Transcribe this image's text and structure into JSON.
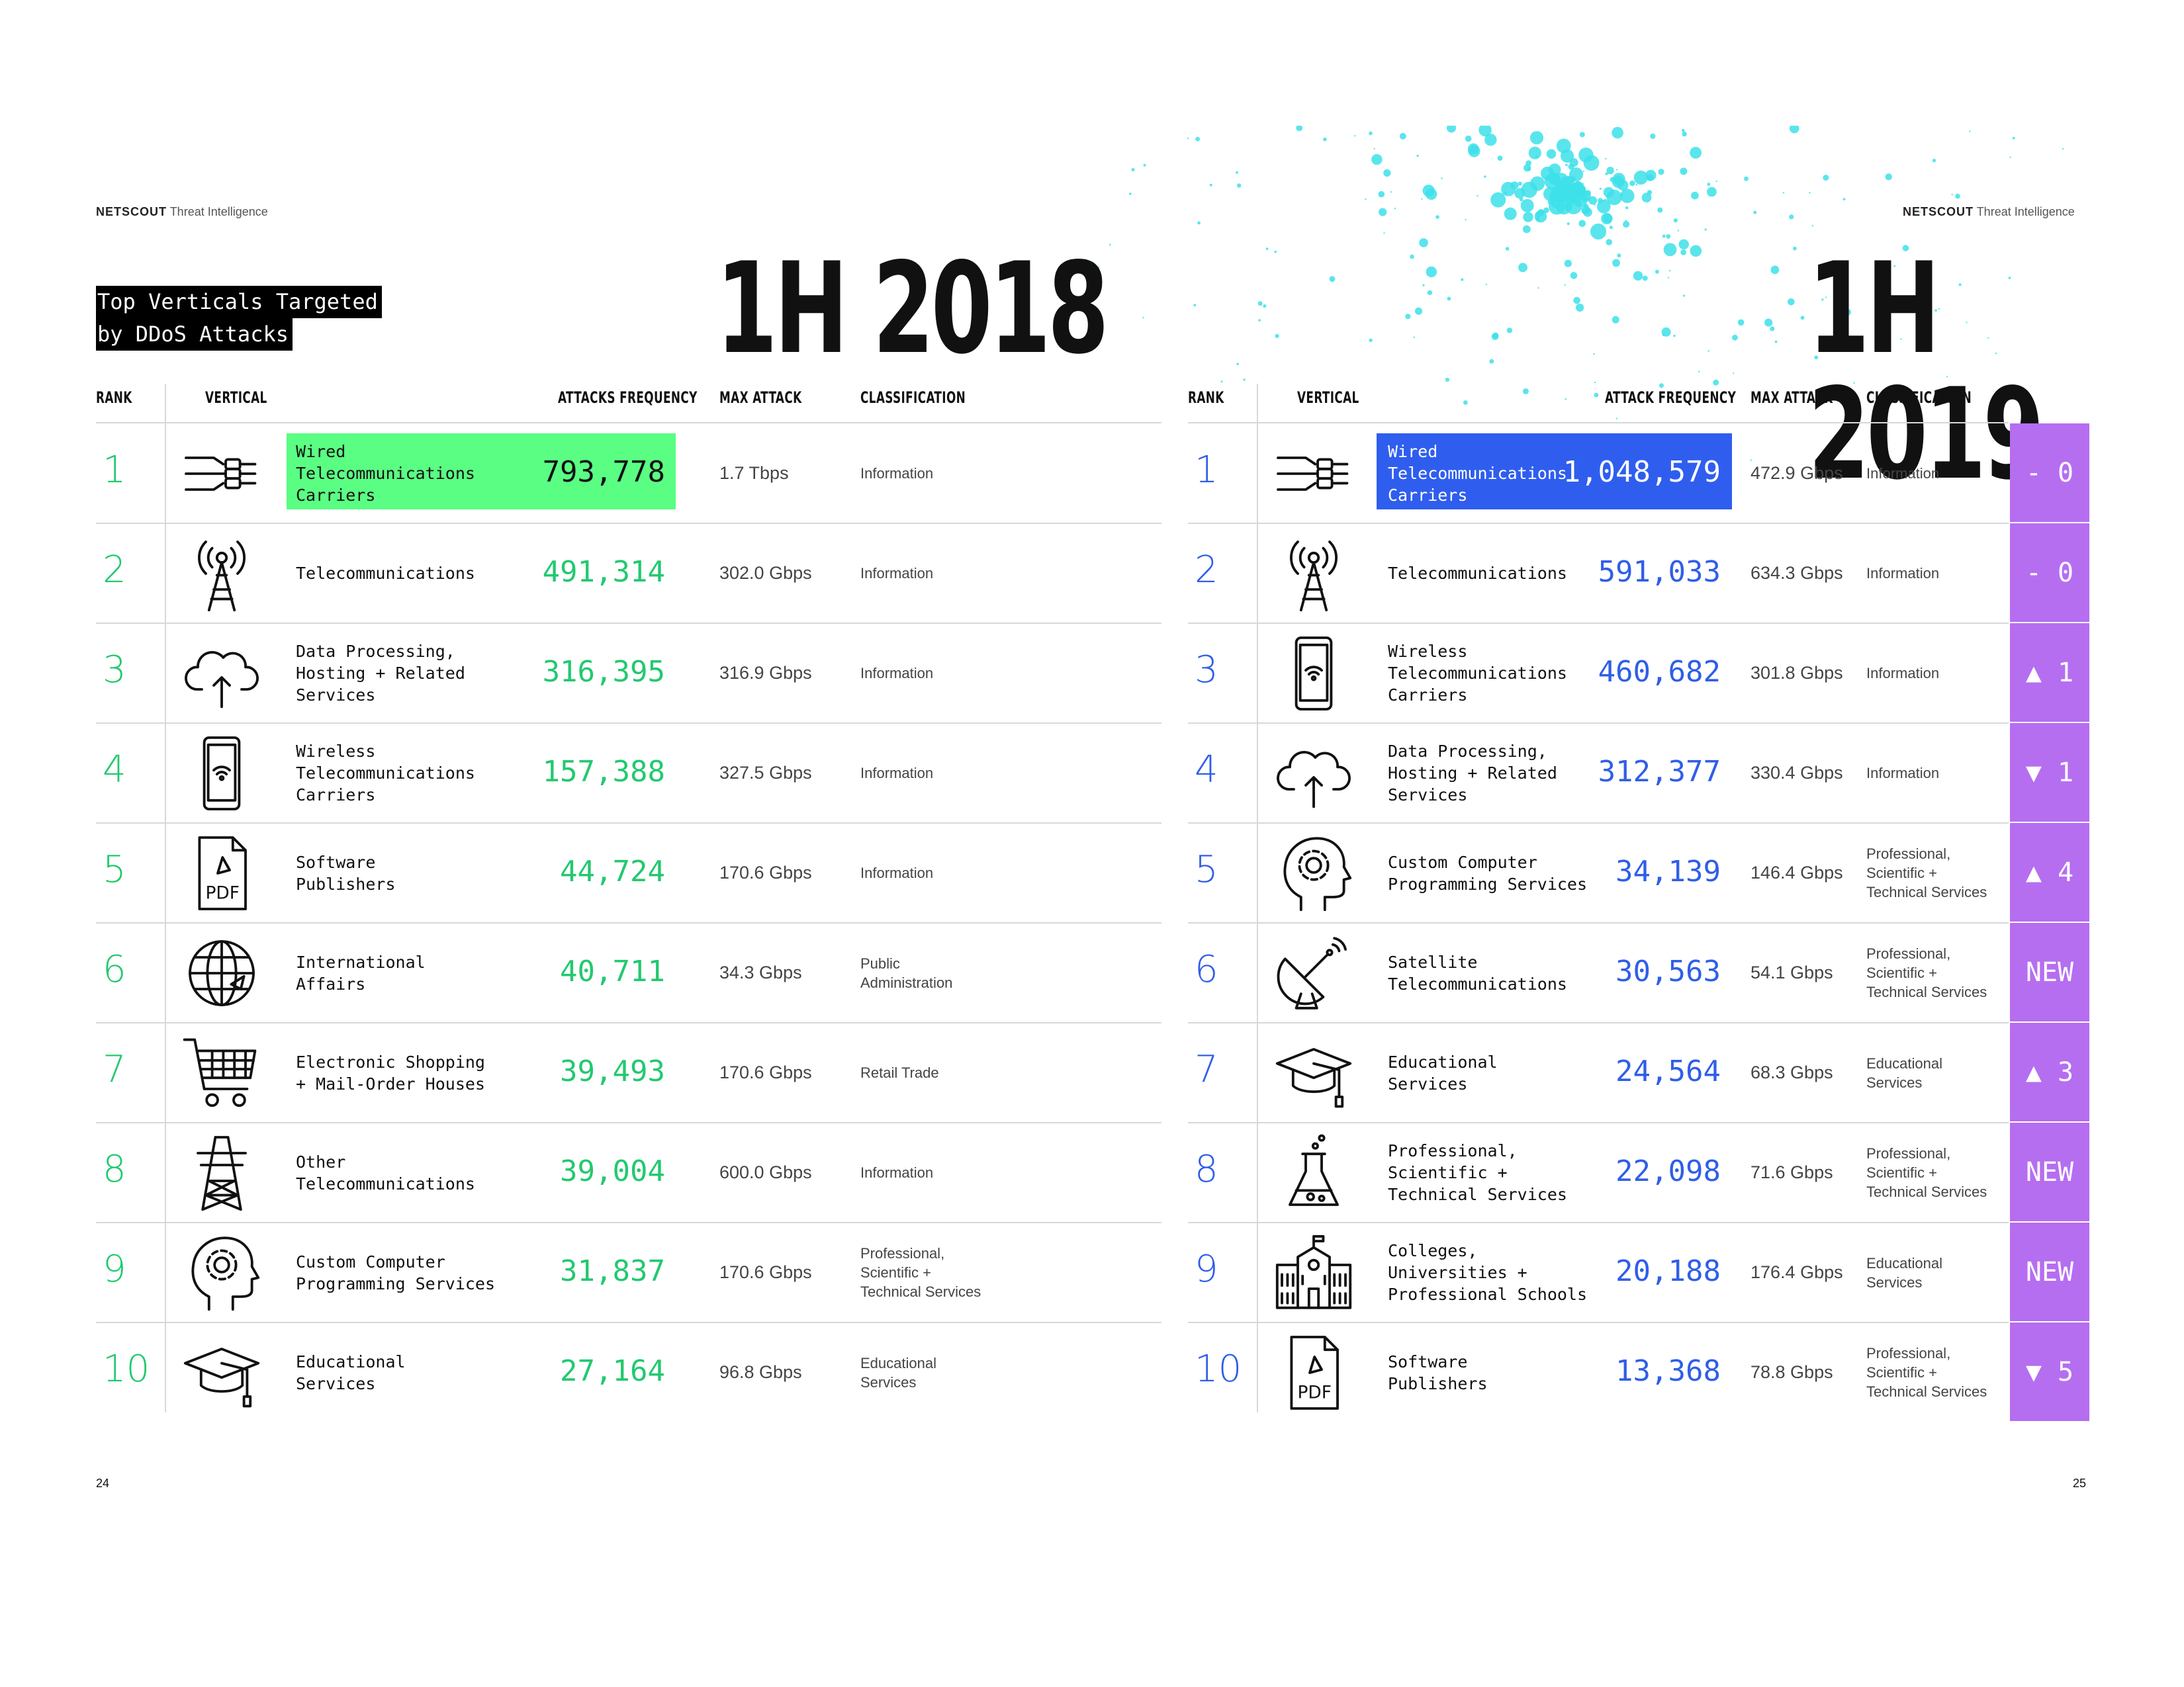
{
  "brand": {
    "name": "NETSCOUT",
    "sub": "Threat Intelligence"
  },
  "title_lines": [
    "Top Verticals Targeted",
    "by DDoS Attacks"
  ],
  "left": {
    "year": "1H 2018",
    "headers": {
      "rank": "RANK",
      "vertical": "VERTICAL",
      "freq": "ATTACKS FREQUENCY",
      "max": "MAX ATTACK",
      "cls": "CLASSIFICATION"
    },
    "rows": [
      {
        "rank": "1",
        "vertical": "Wired\nTelecommunications\nCarriers",
        "freq": "793,778",
        "max": "1.7 Tbps",
        "cls": "Information",
        "icon": "cable-plug-icon"
      },
      {
        "rank": "2",
        "vertical": "Telecommunications",
        "freq": "491,314",
        "max": "302.0 Gbps",
        "cls": "Information",
        "icon": "radio-tower-icon"
      },
      {
        "rank": "3",
        "vertical": "Data Processing,\nHosting + Related\nServices",
        "freq": "316,395",
        "max": "316.9 Gbps",
        "cls": "Information",
        "icon": "cloud-upload-icon"
      },
      {
        "rank": "4",
        "vertical": "Wireless\nTelecommunications\nCarriers",
        "freq": "157,388",
        "max": "327.5 Gbps",
        "cls": "Information",
        "icon": "smartphone-wifi-icon"
      },
      {
        "rank": "5",
        "vertical": "Software\nPublishers",
        "freq": "44,724",
        "max": "170.6 Gbps",
        "cls": "Information",
        "icon": "pdf-file-icon"
      },
      {
        "rank": "6",
        "vertical": "International\nAffairs",
        "freq": "40,711",
        "max": "34.3 Gbps",
        "cls": "Public\nAdministration",
        "icon": "globe-plane-icon"
      },
      {
        "rank": "7",
        "vertical": "Electronic Shopping\n+ Mail-Order Houses",
        "freq": "39,493",
        "max": "170.6 Gbps",
        "cls": "Retail Trade",
        "icon": "shopping-cart-icon"
      },
      {
        "rank": "8",
        "vertical": "Other\nTelecommunications",
        "freq": "39,004",
        "max": "600.0 Gbps",
        "cls": "Information",
        "icon": "power-pylon-icon"
      },
      {
        "rank": "9",
        "vertical": "Custom Computer\nProgramming Services",
        "freq": "31,837",
        "max": "170.6 Gbps",
        "cls": "Professional,\nScientific +\nTechnical Services",
        "icon": "head-gear-icon"
      },
      {
        "rank": "10",
        "vertical": "Educational\nServices",
        "freq": "27,164",
        "max": "96.8 Gbps",
        "cls": "Educational\nServices",
        "icon": "graduation-cap-icon"
      }
    ]
  },
  "right": {
    "year": "1H 2019",
    "headers": {
      "rank": "RANK",
      "vertical": "VERTICAL",
      "freq": "ATTACK FREQUENCY",
      "max": "MAX ATTACK",
      "cls": "CLASSIFICATION"
    },
    "rows": [
      {
        "rank": "1",
        "vertical": "Wired\nTelecommunications\nCarriers",
        "freq": "1,048,579",
        "max": "472.9 Gbps",
        "cls": "Information",
        "change": "- 0",
        "icon": "cable-plug-icon"
      },
      {
        "rank": "2",
        "vertical": "Telecommunications",
        "freq": "591,033",
        "max": "634.3 Gbps",
        "cls": "Information",
        "change": "- 0",
        "icon": "radio-tower-icon"
      },
      {
        "rank": "3",
        "vertical": "Wireless\nTelecommunications\nCarriers",
        "freq": "460,682",
        "max": "301.8 Gbps",
        "cls": "Information",
        "change": "▲ 1",
        "icon": "smartphone-wifi-icon"
      },
      {
        "rank": "4",
        "vertical": "Data Processing,\nHosting + Related\nServices",
        "freq": "312,377",
        "max": "330.4 Gbps",
        "cls": "Information",
        "change": "▼ 1",
        "icon": "cloud-upload-icon"
      },
      {
        "rank": "5",
        "vertical": "Custom Computer\nProgramming Services",
        "freq": "34,139",
        "max": "146.4 Gbps",
        "cls": "Professional,\nScientific +\nTechnical Services",
        "change": "▲ 4",
        "icon": "head-gear-icon"
      },
      {
        "rank": "6",
        "vertical": "Satellite\nTelecommunications",
        "freq": "30,563",
        "max": "54.1 Gbps",
        "cls": "Professional,\nScientific +\nTechnical Services",
        "change": "NEW",
        "icon": "satellite-dish-icon"
      },
      {
        "rank": "7",
        "vertical": "Educational\nServices",
        "freq": "24,564",
        "max": "68.3 Gbps",
        "cls": "Educational\nServices",
        "change": "▲ 3",
        "icon": "graduation-cap-icon"
      },
      {
        "rank": "8",
        "vertical": "Professional,\nScientific +\nTechnical Services",
        "freq": "22,098",
        "max": "71.6 Gbps",
        "cls": "Professional,\nScientific +\nTechnical Services",
        "change": "NEW",
        "icon": "lab-flask-icon"
      },
      {
        "rank": "9",
        "vertical": "Colleges,\nUniversities +\nProfessional Schools",
        "freq": "20,188",
        "max": "176.4 Gbps",
        "cls": "Educational\nServices",
        "change": "NEW",
        "icon": "school-building-icon"
      },
      {
        "rank": "10",
        "vertical": "Software\nPublishers",
        "freq": "13,368",
        "max": "78.8 Gbps",
        "cls": "Professional,\nScientific +\nTechnical Services",
        "change": "▼ 5",
        "icon": "pdf-file-icon"
      }
    ]
  },
  "page_numbers": {
    "left": "24",
    "right": "25"
  },
  "colors": {
    "green": "#22c96f",
    "highlight_green": "#5afe83",
    "blue": "#2f5ee8",
    "highlight_blue": "#2f5eef",
    "purple": "#b56ef0",
    "splatter": "#3de0ea"
  }
}
